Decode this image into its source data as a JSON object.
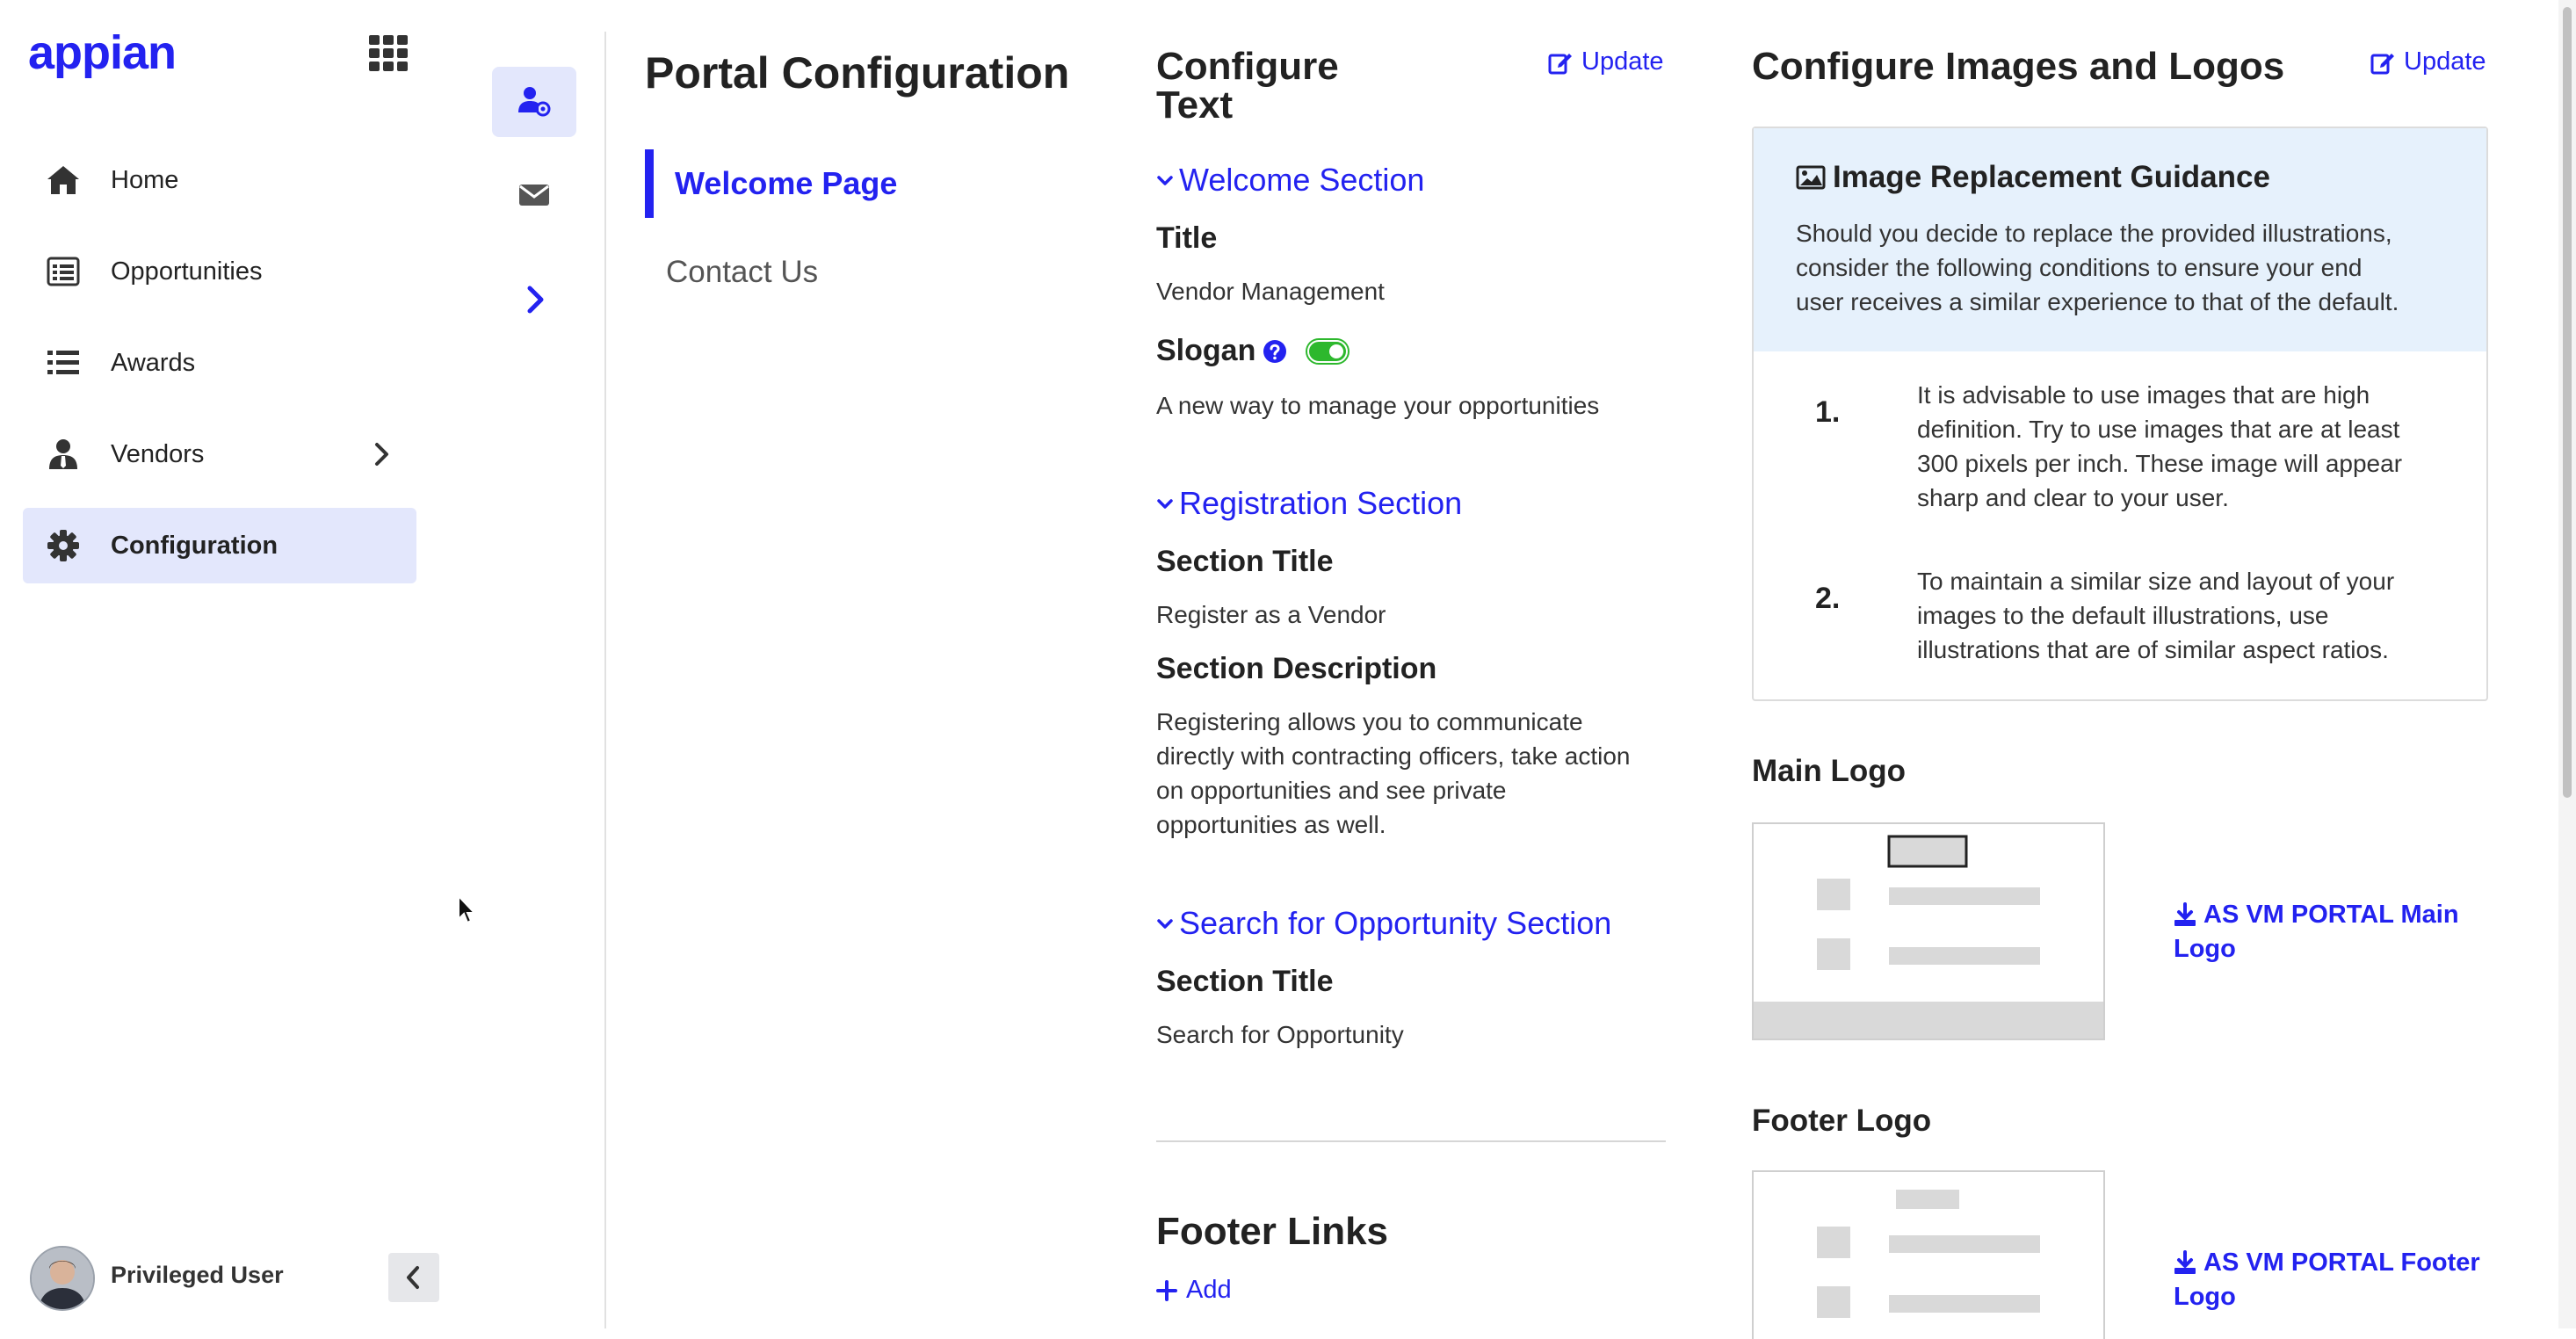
{
  "app": {
    "logo_text": "appian"
  },
  "nav": {
    "items": [
      {
        "label": "Home",
        "icon": "home-icon"
      },
      {
        "label": "Opportunities",
        "icon": "list-alt-icon"
      },
      {
        "label": "Awards",
        "icon": "list-icon"
      },
      {
        "label": "Vendors",
        "icon": "user-tie-icon"
      },
      {
        "label": "Configuration",
        "icon": "gear-icon",
        "active": true
      }
    ]
  },
  "user": {
    "name": "Privileged User"
  },
  "portal": {
    "title": "Portal Configuration",
    "subnav": [
      {
        "label": "Welcome Page",
        "active": true
      },
      {
        "label": "Contact Us"
      }
    ]
  },
  "configure_text": {
    "heading_line1": "Configure",
    "heading_line2": "Text",
    "update_label": "Update",
    "welcome_section": {
      "heading": "Welcome Section",
      "title_label": "Title",
      "title_value": "Vendor Management",
      "slogan_label": "Slogan",
      "slogan_enabled": true,
      "slogan_value": "A new way to manage your opportunities"
    },
    "registration_section": {
      "heading": "Registration Section",
      "section_title_label": "Section Title",
      "section_title_value": "Register as a Vendor",
      "section_description_label": "Section Description",
      "section_description_lines": [
        "Registering allows you to communicate",
        "directly with contracting officers, take action",
        "on opportunities and see private",
        "opportunities as well."
      ]
    },
    "search_section": {
      "heading": "Search for Opportunity Section",
      "section_title_label": "Section Title",
      "section_title_value": "Search for Opportunity"
    },
    "footer_links": {
      "heading": "Footer Links",
      "add_label": "Add"
    }
  },
  "configure_images": {
    "heading": "Configure Images and Logos",
    "update_label": "Update",
    "guidance": {
      "title": "Image Replacement Guidance",
      "intro_lines": [
        "Should you decide to replace the provided illustrations,",
        "consider the following conditions to ensure your end",
        "user receives a similar experience to that of the default."
      ],
      "items": [
        {
          "number": "1.",
          "lines": [
            "It is advisable to use images that are high",
            "definition. Try to use images that are at least",
            "300 pixels per inch. These image will appear",
            "sharp and clear to your user."
          ]
        },
        {
          "number": "2.",
          "lines": [
            "To maintain a similar size and layout of your",
            "images to the default illustrations, use",
            "illustrations that are of similar aspect ratios."
          ]
        }
      ]
    },
    "main_logo": {
      "label": "Main Logo",
      "link_lines": [
        "AS VM PORTAL Main",
        "Logo"
      ]
    },
    "footer_logo": {
      "label": "Footer Logo",
      "link_lines": [
        "AS VM PORTAL Footer",
        "Logo"
      ]
    }
  },
  "colors": {
    "accent": "#2322F0",
    "active_bg": "#E3E7FC",
    "guidance_bg": "#E6F1FC",
    "toggle_on": "#2DB82D"
  }
}
